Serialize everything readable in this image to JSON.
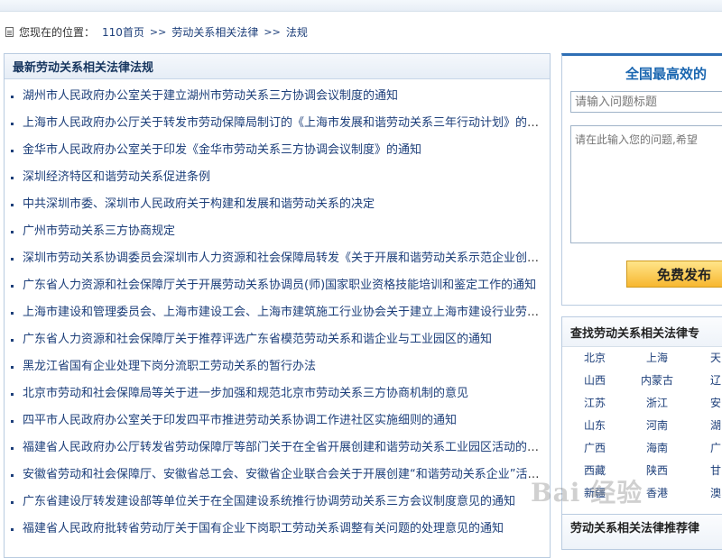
{
  "breadcrumb": {
    "label": "您现在的位置：",
    "home": "110首页",
    "sep1": ">>",
    "category": "劳动关系相关法律",
    "sep2": ">>",
    "current": "法规"
  },
  "main": {
    "title": "最新劳动关系相关法律法规",
    "items": [
      "湖州市人民政府办公室关于建立湖州市劳动关系三方协调会议制度的通知",
      "上海市人民政府办公厅关于转发市劳动保障局制订的《上海市发展和谐劳动关系三年行动计划》的通知",
      "金华市人民政府办公室关于印发《金华市劳动关系三方协调会议制度》的通知",
      "深圳经济特区和谐劳动关系促进条例",
      "中共深圳市委、深圳市人民政府关于构建和发展和谐劳动关系的决定",
      "广州市劳动关系三方协商规定",
      "深圳市劳动关系协调委员会深圳市人力资源和社会保障局转发《关于开展和谐劳动关系示范企业创建活动》的通知",
      "广东省人力资源和社会保障厅关于开展劳动关系协调员(师)国家职业资格技能培训和鉴定工作的通知",
      "上海市建设和管理委员会、上海市建设工会、上海市建筑施工行业协会关于建立上海市建设行业劳动关系三方协商机制的通知",
      "广东省人力资源和社会保障厅关于推荐评选广东省模范劳动关系和谐企业与工业园区的通知",
      "黑龙江省国有企业处理下岗分流职工劳动关系的暂行办法",
      "北京市劳动和社会保障局等关于进一步加强和规范北京市劳动关系三方协商机制的意见",
      "四平市人民政府办公室关于印发四平市推进劳动关系协调工作进社区实施细则的通知",
      "福建省人民政府办公厅转发省劳动保障厅等部门关于在全省开展创建和谐劳动关系工业园区活动的通知",
      "安徽省劳动和社会保障厅、安徽省总工会、安徽省企业联合会关于开展创建“和谐劳动关系企业”活动的通知",
      "广东省建设厅转发建设部等单位关于在全国建设系统推行协调劳动关系三方会议制度意见的通知",
      "福建省人民政府批转省劳动厅关于国有企业下岗职工劳动关系调整有关问题的处理意见的通知"
    ]
  },
  "ask_form": {
    "title": "全国最高效的",
    "title_placeholder": "请输入问题标题",
    "body_placeholder": "请在此输入您的问题,希望",
    "submit_label": "免费发布"
  },
  "region": {
    "title": "查找劳动关系相关法律专",
    "items": [
      "北京",
      "上海",
      "天",
      "山西",
      "内蒙古",
      "辽",
      "江苏",
      "浙江",
      "安",
      "山东",
      "河南",
      "湖",
      "广西",
      "海南",
      "广",
      "西藏",
      "陕西",
      "甘",
      "新疆",
      "香港",
      "澳"
    ]
  },
  "recommend": {
    "title": "劳动关系相关法律推荐律"
  },
  "watermark": "Bai 经验"
}
